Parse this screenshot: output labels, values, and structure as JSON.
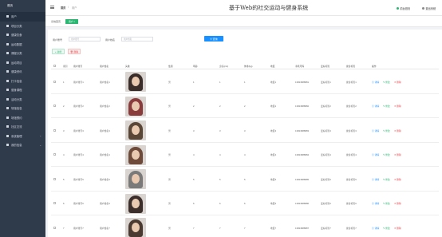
{
  "sidebar": {
    "title": "首页",
    "items": [
      {
        "label": "用户",
        "chevron": false
      },
      {
        "label": "项目分类",
        "chevron": false
      },
      {
        "label": "健康饮食",
        "chevron": false
      },
      {
        "label": "运动数据",
        "chevron": false
      },
      {
        "label": "课程分类",
        "chevron": false
      },
      {
        "label": "运动项目",
        "chevron": false
      },
      {
        "label": "健康资讯",
        "chevron": false
      },
      {
        "label": "打卡信息",
        "chevron": false
      },
      {
        "label": "健身课程",
        "chevron": false
      },
      {
        "label": "活动分类",
        "chevron": false
      },
      {
        "label": "场馆信息",
        "chevron": false
      },
      {
        "label": "场馆预约",
        "chevron": false
      },
      {
        "label": "社区交流",
        "chevron": false
      },
      {
        "label": "系统管理",
        "chevron": true
      },
      {
        "label": "我的信息",
        "chevron": true
      }
    ]
  },
  "header": {
    "crumb_home": "首页",
    "crumb_sep": "/",
    "crumb_current": "用户",
    "title": "基于Web的社交运动与健身系统",
    "btn_home": "前台首页",
    "btn_logout": "退出系统"
  },
  "tabbar": {
    "label": "系统首页",
    "active_tab": "用户 ×"
  },
  "search": {
    "account_label": "用户账号",
    "account_placeholder": "用户账号",
    "name_label": "用户姓名",
    "name_placeholder": "用户姓名",
    "button": "查询"
  },
  "actions": {
    "add": "新增",
    "delete": "删除"
  },
  "table": {
    "headers": [
      "索引",
      "用户账号",
      "用户姓名",
      "头像",
      "性别",
      "年龄",
      "身高(cm)",
      "体重(kg)",
      "地区",
      "手机号码",
      "爱好标签",
      "健身标签",
      "操作"
    ],
    "op_detail": "详情",
    "op_edit": "修改",
    "op_delete": "删除",
    "rows": [
      {
        "index": "1",
        "account": "用户账号1",
        "name": "用户姓名1",
        "gender": "男",
        "age": "1",
        "height": "1",
        "weight": "1",
        "region": "地区1",
        "phone": "13823888881",
        "hobby": "爱好标签1",
        "fitness": "健身标签1",
        "avatar_color": "#3a2d2a"
      },
      {
        "index": "2",
        "account": "用户账号2",
        "name": "用户姓名2",
        "gender": "男",
        "age": "2",
        "height": "2",
        "weight": "2",
        "region": "地区2",
        "phone": "13823888882",
        "hobby": "爱好标签2",
        "fitness": "健身标签2",
        "avatar_color": "#8a3b3b"
      },
      {
        "index": "3",
        "account": "用户账号3",
        "name": "用户姓名3",
        "gender": "男",
        "age": "3",
        "height": "3",
        "weight": "3",
        "region": "地区3",
        "phone": "13823888883",
        "hobby": "爱好标签3",
        "fitness": "健身标签3",
        "avatar_color": "#5a4636"
      },
      {
        "index": "4",
        "account": "用户账号4",
        "name": "用户姓名4",
        "gender": "男",
        "age": "4",
        "height": "4",
        "weight": "4",
        "region": "地区4",
        "phone": "13823888884",
        "hobby": "爱好标签4",
        "fitness": "健身标签4",
        "avatar_color": "#6e4a3a"
      },
      {
        "index": "5",
        "account": "用户账号5",
        "name": "用户姓名5",
        "gender": "男",
        "age": "5",
        "height": "5",
        "weight": "5",
        "region": "地区5",
        "phone": "13823888885",
        "hobby": "爱好标签5",
        "fitness": "健身标签5",
        "avatar_color": "#7a7a7a"
      },
      {
        "index": "6",
        "account": "用户账号6",
        "name": "用户姓名6",
        "gender": "男",
        "age": "6",
        "height": "6",
        "weight": "6",
        "region": "地区6",
        "phone": "13823888886",
        "hobby": "爱好标签6",
        "fitness": "健身标签6",
        "avatar_color": "#3c2f2b"
      },
      {
        "index": "7",
        "account": "用户账号7",
        "name": "用户姓名7",
        "gender": "男",
        "age": "7",
        "height": "7",
        "weight": "7",
        "region": "地区7",
        "phone": "13823888887",
        "hobby": "爱好标签7",
        "fitness": "健身标签7",
        "avatar_color": "#4a3a32"
      }
    ]
  },
  "colors": {
    "sidebar_bg": "#2f3a4b",
    "accent_green": "#2bb673",
    "accent_blue": "#1890ff",
    "danger_red": "#e8474c"
  }
}
